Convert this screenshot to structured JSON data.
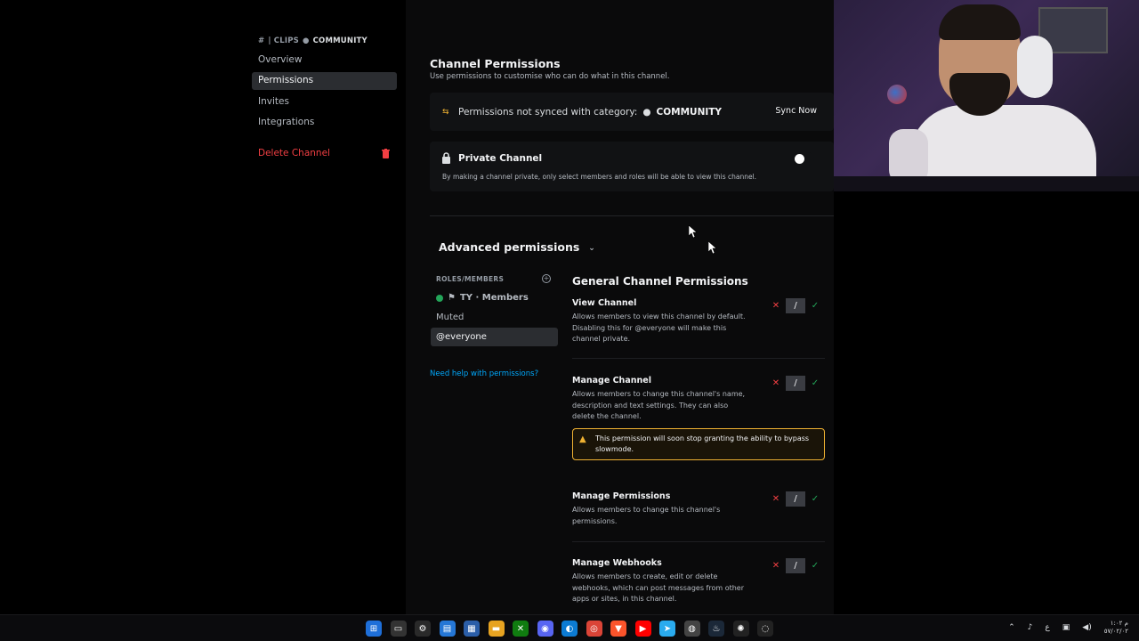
{
  "sidebar": {
    "crumb": {
      "hash": "#",
      "channel": "| CLIPS",
      "category": "COMMUNITY"
    },
    "items": [
      {
        "label": "Overview"
      },
      {
        "label": "Permissions"
      },
      {
        "label": "Invites"
      },
      {
        "label": "Integrations"
      }
    ],
    "delete_label": "Delete Channel"
  },
  "main": {
    "title": "Channel Permissions",
    "subtitle": "Use permissions to customise who can do what in this channel.",
    "sync": {
      "text": "Permissions not synced with category:",
      "category": "COMMUNITY",
      "button": "Sync Now"
    },
    "private": {
      "title": "Private Channel",
      "desc": "By making a channel private, only select members and roles will be able to view this channel."
    },
    "advanced": "Advanced permissions",
    "roles_header": "ROLES/MEMBERS",
    "roles": [
      {
        "label": "TY · Members"
      },
      {
        "label": "Muted"
      },
      {
        "label": "@everyone"
      }
    ],
    "help_link": "Need help with permissions?",
    "general_title": "General Channel Permissions",
    "permissions": [
      {
        "title": "View Channel",
        "desc": "Allows members to view this channel by default. Disabling this for @everyone will make this channel private."
      },
      {
        "title": "Manage Channel",
        "desc": "Allows members to change this channel's name, description and text settings. They can also delete the channel."
      },
      {
        "title": "Manage Permissions",
        "desc": "Allows members to change this channel's permissions."
      },
      {
        "title": "Manage Webhooks",
        "desc": "Allows members to create, edit or delete webhooks, which can post messages from other apps or sites, in this channel."
      }
    ],
    "notice": "This permission will soon stop granting the ability to bypass slowmode.",
    "tri": {
      "deny": "✕",
      "neutral": "/",
      "allow": "✓"
    }
  },
  "colors": {
    "accent": "#00a8fc",
    "danger": "#f23f43",
    "success": "#23a559",
    "warning": "#f0b232"
  },
  "taskbar": {
    "clock_time": "م ١:٠٢",
    "clock_date": "٥٧/٠٢/٠٢",
    "lang": "ع"
  }
}
